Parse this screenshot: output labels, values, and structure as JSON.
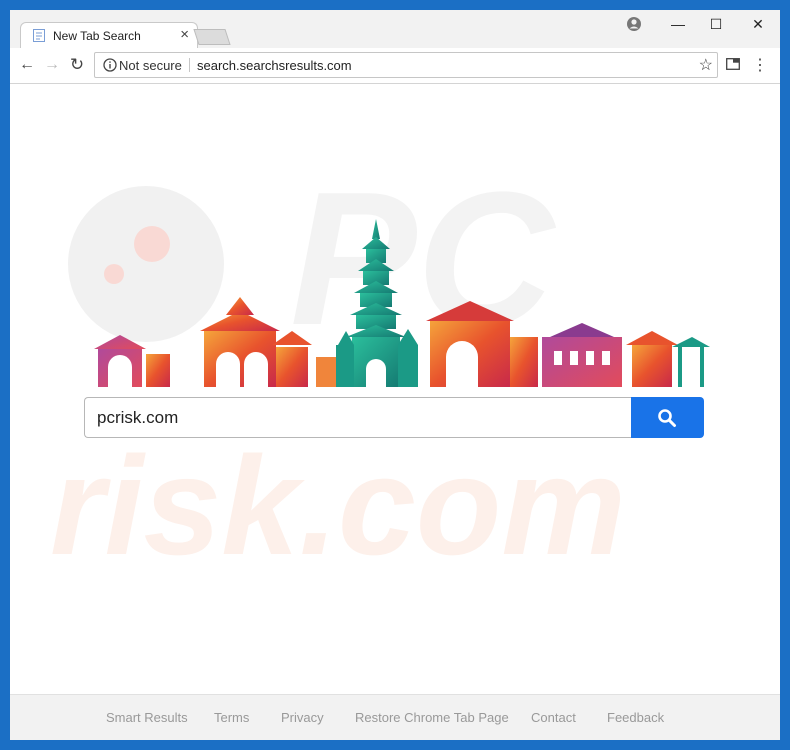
{
  "browser": {
    "tab": {
      "title": "New Tab Search",
      "close_glyph": "×",
      "favicon": "page-icon"
    },
    "window_controls": {
      "profile": "account-icon",
      "minimize": "—",
      "maximize": "☐",
      "close": "✕"
    },
    "nav": {
      "back": "←",
      "forward": "→",
      "reload": "↻"
    },
    "address": {
      "security_label": "Not secure",
      "url": "search.searchsresults.com",
      "star": "☆",
      "menu": "⋮"
    }
  },
  "page": {
    "search": {
      "value": "pcrisk.com",
      "placeholder": ""
    },
    "footer_links": [
      "Smart Results",
      "Terms",
      "Privacy",
      "Restore Chrome Tab Page",
      "Contact",
      "Feedback"
    ]
  },
  "watermark": {
    "text": "risk.com",
    "glyph": "PC"
  },
  "colors": {
    "window_border": "#1b6fc5",
    "search_button": "#1973e8",
    "footer_bg": "#f2f2f2",
    "footer_text": "#999999",
    "skyline_orange": "#e8532d",
    "skyline_teal": "#1b9a86",
    "skyline_purple": "#8a3b8f"
  }
}
